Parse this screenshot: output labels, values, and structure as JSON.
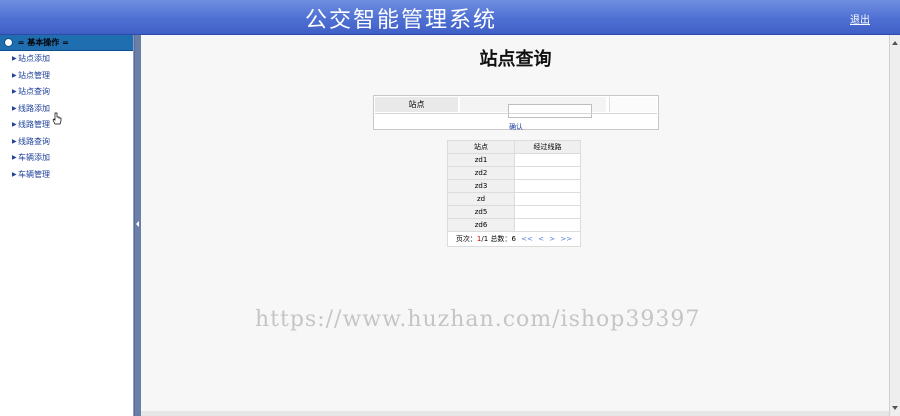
{
  "header": {
    "title": "公交智能管理系统",
    "logout": "退出"
  },
  "sidebar": {
    "group_title": "= 基本操作 =",
    "items": [
      {
        "label": "站点添加"
      },
      {
        "label": "站点管理"
      },
      {
        "label": "站点查询"
      },
      {
        "label": "线路添加"
      },
      {
        "label": "线路管理"
      },
      {
        "label": "线路查询"
      },
      {
        "label": "车辆添加"
      },
      {
        "label": "车辆管理"
      }
    ]
  },
  "main": {
    "page_title": "站点查询",
    "search": {
      "label": "站点",
      "value": "",
      "confirm": "确认"
    },
    "table": {
      "headers": [
        "站点",
        "经过线路"
      ],
      "rows": [
        {
          "name": "zd1",
          "routes": ""
        },
        {
          "name": "zd2",
          "routes": ""
        },
        {
          "name": "zd3",
          "routes": ""
        },
        {
          "name": "zd",
          "routes": ""
        },
        {
          "name": "zd5",
          "routes": ""
        },
        {
          "name": "zd6",
          "routes": ""
        }
      ]
    },
    "pager": {
      "page_label": "页次：",
      "current": "1",
      "total_pages": "/1",
      "total_label": "总数：",
      "total": "6",
      "first": "<<",
      "prev": "<",
      "next": ">",
      "last": ">>"
    }
  },
  "watermark": "https://www.huzhan.com/ishop39397",
  "colors": {
    "header": "#4f70d3",
    "sidebar_group": "#1f6fb0",
    "splitter": "#6b7fa6",
    "link": "#1d3f9a"
  }
}
